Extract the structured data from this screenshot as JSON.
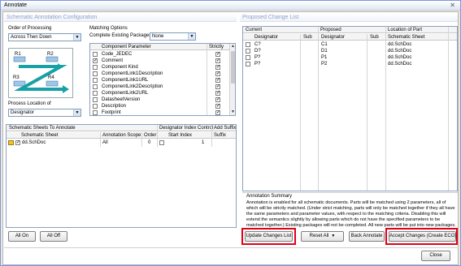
{
  "window": {
    "title": "Annotate",
    "close_glyph": "✕"
  },
  "left_panel": {
    "title": "Schematic Annotation Configuration",
    "order": {
      "label": "Order of Processing",
      "value": "Across Then Down"
    },
    "diagram": {
      "labels": [
        "R1",
        "R2",
        "R3",
        "R4"
      ]
    },
    "process_location": {
      "label": "Process Location of",
      "value": "Designator"
    },
    "matching": {
      "label": "Matching Options",
      "complete_label": "Complete Existing Packages",
      "complete_value": "None",
      "columns": [
        "Component Parameter",
        "Strictly"
      ],
      "rows": [
        {
          "name": "Code_JEDEC",
          "checked": false,
          "strictly": true
        },
        {
          "name": "Comment",
          "checked": true,
          "strictly": true
        },
        {
          "name": "Component Kind",
          "checked": false,
          "strictly": true
        },
        {
          "name": "ComponentLink1Description",
          "checked": false,
          "strictly": true
        },
        {
          "name": "ComponentLink1URL",
          "checked": false,
          "strictly": true
        },
        {
          "name": "ComponentLink2Description",
          "checked": false,
          "strictly": true
        },
        {
          "name": "ComponentLink2URL",
          "checked": false,
          "strictly": true
        },
        {
          "name": "DatasheetVersion",
          "checked": false,
          "strictly": true
        },
        {
          "name": "Description",
          "checked": false,
          "strictly": true
        },
        {
          "name": "Footprint",
          "checked": false,
          "strictly": true
        }
      ]
    },
    "sheets": {
      "group_headers": [
        "Schematic Sheets To Annotate",
        "Designator Index Control",
        "Add Suffix"
      ],
      "columns": [
        "Schematic Sheet",
        "Annotation Scope",
        "Order",
        "Start Index",
        "Suffix"
      ],
      "rows": [
        {
          "sheet": "dd.SchDoc",
          "checked": true,
          "scope": "All",
          "order": "0",
          "start_checked": false,
          "start_index": "1",
          "suffix": ""
        }
      ]
    },
    "buttons": {
      "all_on": "All On",
      "all_off": "All Off"
    }
  },
  "right_panel": {
    "title": "Proposed Change List",
    "group_headers": [
      "Current",
      "Proposed",
      "Location of Part"
    ],
    "columns": [
      "Designator",
      "Sub",
      "Designator",
      "Sub",
      "Schematic Sheet"
    ],
    "rows": [
      {
        "current": "C?",
        "sub": "",
        "proposed": "C1",
        "psub": "",
        "sheet": "dd.SchDoc"
      },
      {
        "current": "D?",
        "sub": "",
        "proposed": "D1",
        "psub": "",
        "sheet": "dd.SchDoc"
      },
      {
        "current": "P?",
        "sub": "",
        "proposed": "P1",
        "psub": "",
        "sheet": "dd.SchDoc"
      },
      {
        "current": "P?",
        "sub": "",
        "proposed": "P2",
        "psub": "",
        "sheet": "dd.SchDoc"
      }
    ],
    "summary": {
      "title": "Annotation Summary",
      "text": "Annotation is enabled for all schematic documents. Parts will be matched using 2 parameters, all of which will be strictly matched. (Under strict matching, parts will only be matched together if they all have the same parameters and parameter values, with respect to the matching criteria. Disabling this will extend the semantics slightly by allowing parts which do not have the specified parameters to be matched together.) Existing packages will not be completed. All new parts will be put into new packages."
    },
    "buttons": {
      "update": "Update Changes List",
      "reset": "Reset All",
      "back": "Back Annotate",
      "accept": "Accept Changes (Create ECO)"
    }
  },
  "footer": {
    "close": "Close"
  },
  "colors": {
    "highlight": "#e0001a",
    "panel_title": "#8ea0c8",
    "accent": "#1a6fb5"
  }
}
